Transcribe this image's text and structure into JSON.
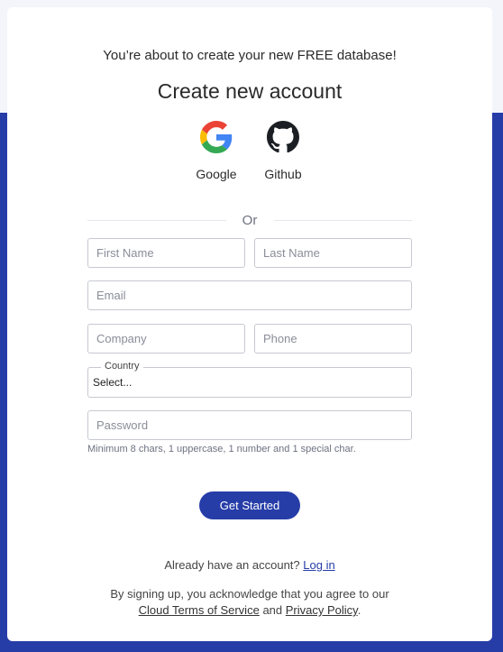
{
  "header": {
    "subtitle": "You’re about to create your new FREE database!",
    "title": "Create new account"
  },
  "providers": [
    {
      "label": "Google",
      "icon": "google-icon"
    },
    {
      "label": "Github",
      "icon": "github-icon"
    }
  ],
  "divider": {
    "text": "Or"
  },
  "form": {
    "first_name_placeholder": "First Name",
    "last_name_placeholder": "Last Name",
    "email_placeholder": "Email",
    "company_placeholder": "Company",
    "phone_placeholder": "Phone",
    "country": {
      "label": "Country",
      "value": "Select..."
    },
    "password_placeholder": "Password",
    "password_hint": "Minimum 8 chars, 1 uppercase, 1 number and 1 special char.",
    "submit_label": "Get Started"
  },
  "footer": {
    "login_prompt": "Already have an account?",
    "login_link": "Log in",
    "legal_prefix": "By signing up, you acknowledge that you agree to our",
    "terms_link": "Cloud Terms of Service",
    "legal_and": "and",
    "privacy_link": "Privacy Policy",
    "legal_suffix": "."
  },
  "colors": {
    "brand": "#263da8",
    "background": "#f4f5fb",
    "card": "#ffffff"
  }
}
